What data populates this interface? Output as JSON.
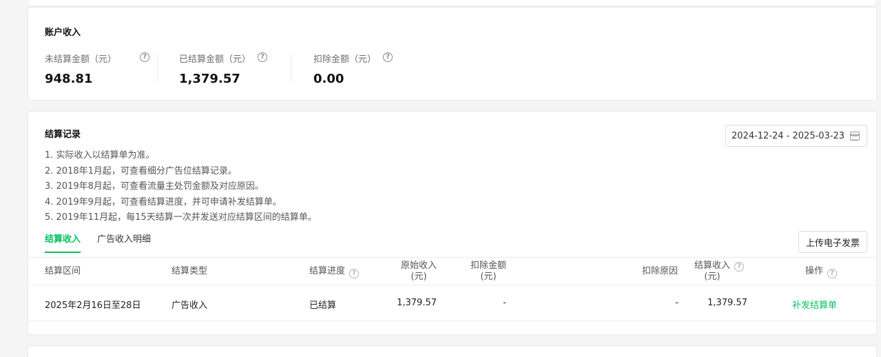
{
  "account": {
    "title": "账户收入",
    "metrics": [
      {
        "label": "未结算金额（元）",
        "value": "948.81"
      },
      {
        "label": "已结算金额（元）",
        "value": "1,379.57"
      },
      {
        "label": "扣除金额（元）",
        "value": "0.00"
      }
    ]
  },
  "settlement": {
    "title": "结算记录",
    "date_range": "2024-12-24 - 2025-03-23",
    "notes": [
      "1. 实际收入以结算单为准。",
      "2. 2018年1月起，可查看细分广告位结算记录。",
      "3. 2019年8月起，可查看流量主处罚金额及对应原因。",
      "4. 2019年9月起，可查看结算进度，并可申请补发结算单。",
      "5. 2019年11月起，每15天结算一次并发送对应结算区间的结算单。"
    ],
    "tabs": [
      "结算收入",
      "广告收入明细"
    ],
    "upload_button": "上传电子发票",
    "table": {
      "headers": {
        "period": "结算区间",
        "type": "结算类型",
        "progress": "结算进度",
        "original_income_1": "原始收入",
        "original_income_2": "(元)",
        "deduction_1": "扣除金额",
        "deduction_2": "(元)",
        "deduction_reason": "扣除原因",
        "settled_income_1": "结算收入",
        "settled_income_2": "(元)",
        "action": "操作"
      },
      "rows": [
        {
          "period": "2025年2月16日至28日",
          "type": "广告收入",
          "progress": "已结算",
          "original_income": "1,379.57",
          "deduction": "-",
          "deduction_reason": "-",
          "settled_income": "1,379.57",
          "action": "补发结算单"
        }
      ]
    }
  },
  "colors": {
    "accent": "#07c160",
    "background": "#f5f5f5"
  }
}
